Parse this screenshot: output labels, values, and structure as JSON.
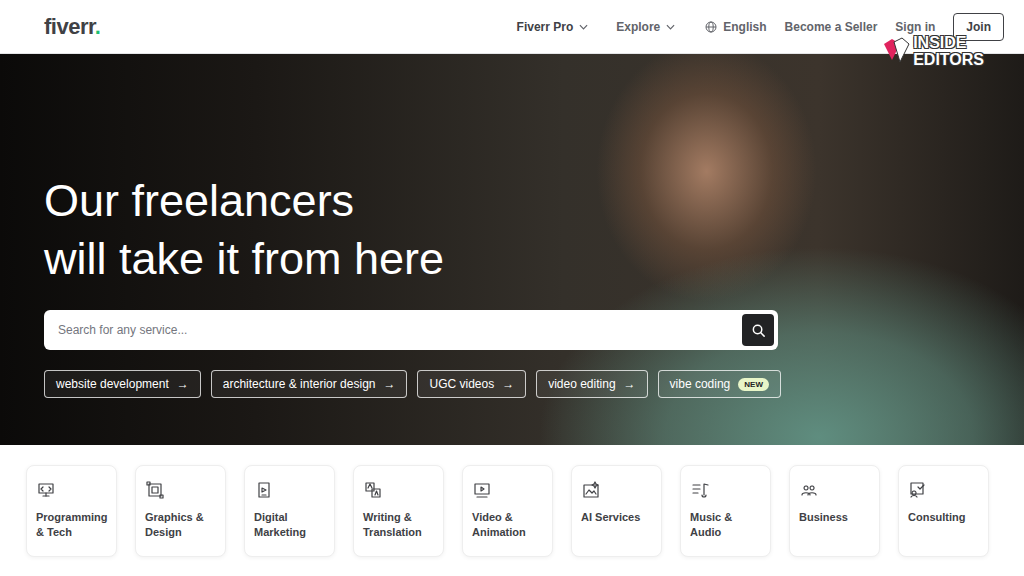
{
  "logo": {
    "text": "fiverr",
    "dot": "."
  },
  "nav": {
    "menus": [
      {
        "label": "Fiverr Pro"
      },
      {
        "label": "Explore"
      }
    ],
    "language": "English",
    "links": [
      "Become a Seller",
      "Sign in"
    ],
    "join": "Join"
  },
  "watermark": {
    "lines": [
      "INSIDE",
      "EDITORS"
    ]
  },
  "hero": {
    "headline": [
      "Our freelancers",
      "will take it from here"
    ],
    "search": {
      "placeholder": "Search for any service..."
    },
    "chips": [
      {
        "label": "website development",
        "kind": "arrow",
        "mark": "→"
      },
      {
        "label": "architecture & interior design",
        "kind": "arrow",
        "mark": "→"
      },
      {
        "label": "UGC videos",
        "kind": "arrow",
        "mark": "→"
      },
      {
        "label": "video editing",
        "kind": "arrow",
        "mark": "→"
      },
      {
        "label": "vibe coding",
        "kind": "badge",
        "mark": "NEW"
      }
    ]
  },
  "categories": [
    {
      "label": "Programming & Tech"
    },
    {
      "label": "Graphics & Design"
    },
    {
      "label": "Digital Marketing"
    },
    {
      "label": "Writing & Translation"
    },
    {
      "label": "Video & Animation"
    },
    {
      "label": "AI Services"
    },
    {
      "label": "Music & Audio"
    },
    {
      "label": "Business"
    },
    {
      "label": "Consulting"
    }
  ]
}
